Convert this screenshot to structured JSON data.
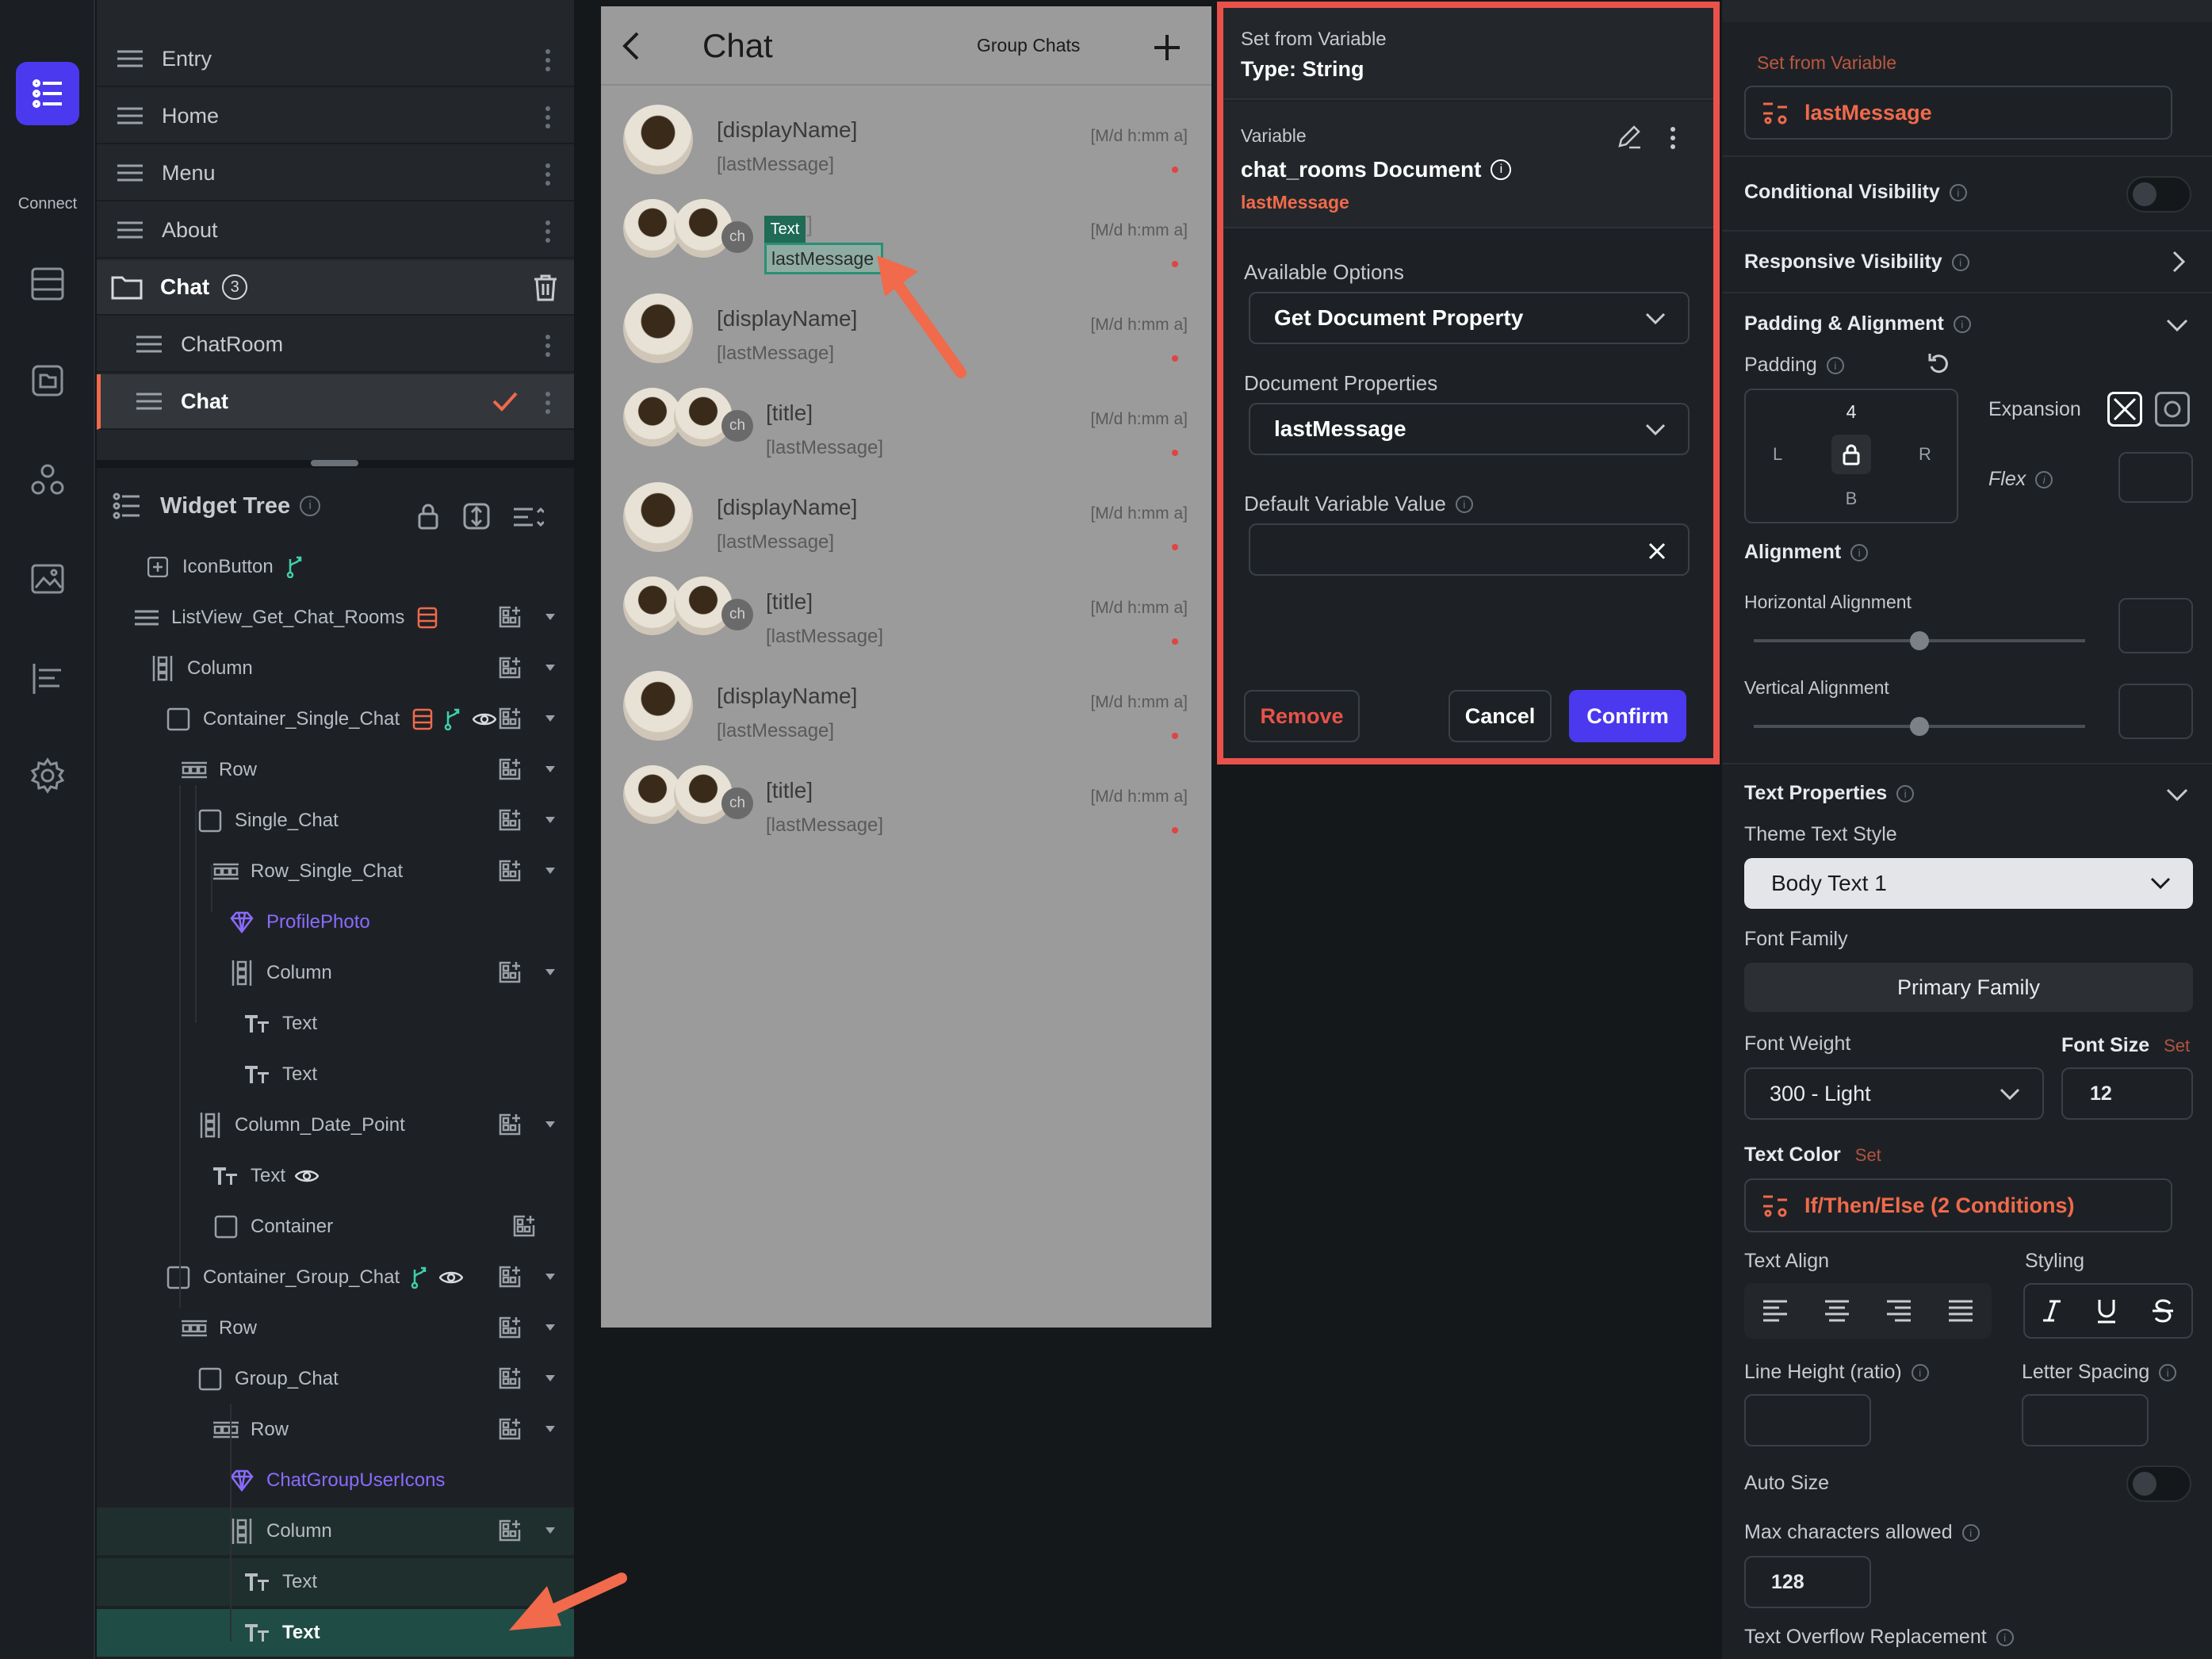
{
  "rail": {
    "connect_label": "Connect"
  },
  "pages": {
    "items": [
      {
        "label": "Entry"
      },
      {
        "label": "Home"
      },
      {
        "label": "Menu"
      },
      {
        "label": "About"
      }
    ],
    "folder": {
      "label": "Chat",
      "count": "3"
    },
    "sub_items": [
      {
        "label": "ChatRoom"
      },
      {
        "label": "Chat"
      }
    ]
  },
  "tree": {
    "title": "Widget Tree",
    "nodes": [
      {
        "label": "IconButton"
      },
      {
        "label": "ListView_Get_Chat_Rooms"
      },
      {
        "label": "Column"
      },
      {
        "label": "Container_Single_Chat"
      },
      {
        "label": "Row"
      },
      {
        "label": "Single_Chat"
      },
      {
        "label": "Row_Single_Chat"
      },
      {
        "label": "ProfilePhoto"
      },
      {
        "label": "Column"
      },
      {
        "label": "Text"
      },
      {
        "label": "Text"
      },
      {
        "label": "Column_Date_Point"
      },
      {
        "label": "Text"
      },
      {
        "label": "Container"
      },
      {
        "label": "Container_Group_Chat"
      },
      {
        "label": "Row"
      },
      {
        "label": "Group_Chat"
      },
      {
        "label": "Row"
      },
      {
        "label": "ChatGroupUserIcons"
      },
      {
        "label": "Column"
      },
      {
        "label": "Text"
      },
      {
        "label": "Text"
      }
    ]
  },
  "phone": {
    "title": "Chat",
    "group_chats": "Group Chats",
    "selected_tag": "Text",
    "selected_value": "lastMessage",
    "rows": [
      {
        "name": "[displayName]",
        "sub": "[lastMessage]",
        "date": "[M/d h:mm a]",
        "group": false
      },
      {
        "name": "[title]",
        "sub": "lastMessage",
        "date": "[M/d h:mm a]",
        "group": true
      },
      {
        "name": "[displayName]",
        "sub": "[lastMessage]",
        "date": "[M/d h:mm a]",
        "group": false
      },
      {
        "name": "[title]",
        "sub": "[lastMessage]",
        "date": "[M/d h:mm a]",
        "group": true
      },
      {
        "name": "[displayName]",
        "sub": "[lastMessage]",
        "date": "[M/d h:mm a]",
        "group": false
      },
      {
        "name": "[title]",
        "sub": "[lastMessage]",
        "date": "[M/d h:mm a]",
        "group": true
      },
      {
        "name": "[displayName]",
        "sub": "[lastMessage]",
        "date": "[M/d h:mm a]",
        "group": false
      },
      {
        "name": "[title]",
        "sub": "[lastMessage]",
        "date": "[M/d h:mm a]",
        "group": true
      }
    ],
    "avatar_initials": "ch"
  },
  "modal": {
    "header_title": "Set from Variable",
    "header_type": "Type: String",
    "variable_label": "Variable",
    "variable_name": "chat_rooms Document",
    "variable_field": "lastMessage",
    "available_options_label": "Available Options",
    "available_options_value": "Get Document Property",
    "document_properties_label": "Document Properties",
    "document_properties_value": "lastMessage",
    "default_value_label": "Default Variable Value",
    "default_value": "",
    "remove": "Remove",
    "cancel": "Cancel",
    "confirm": "Confirm"
  },
  "props": {
    "set_from_variable": "Set from Variable",
    "variable_value": "lastMessage",
    "conditional_visibility": "Conditional Visibility",
    "responsive_visibility": "Responsive Visibility",
    "padding_alignment": "Padding & Alignment",
    "padding": "Padding",
    "padding_top": "4",
    "padding_left": "L",
    "padding_right": "R",
    "padding_bottom": "B",
    "expansion": "Expansion",
    "flex": "Flex",
    "alignment": "Alignment",
    "horizontal_alignment": "Horizontal Alignment",
    "vertical_alignment": "Vertical Alignment",
    "text_properties": "Text Properties",
    "theme_text_style": "Theme Text Style",
    "theme_text_style_value": "Body Text 1",
    "font_family": "Font Family",
    "font_family_value": "Primary Family",
    "font_weight": "Font Weight",
    "font_weight_value": "300 - Light",
    "font_size": "Font Size",
    "font_size_set": "Set",
    "font_size_value": "12",
    "text_color": "Text Color",
    "text_color_set": "Set",
    "text_color_value": "If/Then/Else (2 Conditions)",
    "text_align": "Text Align",
    "styling": "Styling",
    "line_height": "Line Height (ratio)",
    "letter_spacing": "Letter Spacing",
    "auto_size": "Auto Size",
    "max_chars": "Max characters allowed",
    "max_chars_value": "128",
    "overflow_replacement": "Text Overflow Replacement"
  },
  "colors": {
    "accent": "#4b39ef",
    "brand_orange": "#f06a4b",
    "red_border": "#e8524a",
    "teal_highlight": "#1f4d45"
  }
}
